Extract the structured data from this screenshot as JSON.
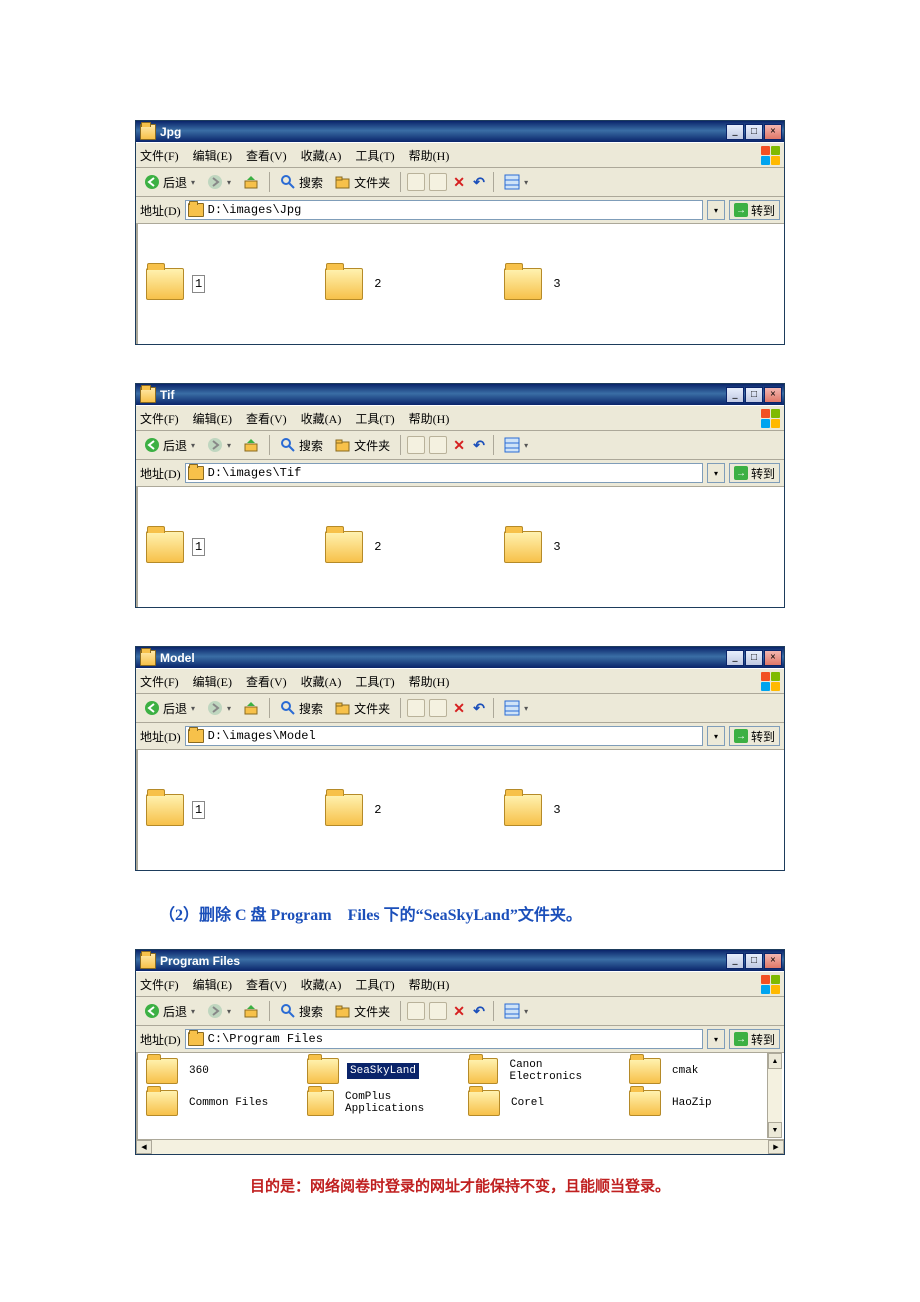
{
  "menu": {
    "file": "文件(F)",
    "edit": "编辑(E)",
    "view": "查看(V)",
    "favorites": "收藏(A)",
    "tools": "工具(T)",
    "help": "帮助(H)"
  },
  "toolbar": {
    "back": "后退",
    "search": "搜索",
    "folders": "文件夹"
  },
  "address": {
    "label": "地址(D)",
    "go": "转到"
  },
  "windows": [
    {
      "title": "Jpg",
      "path": "D:\\images\\Jpg",
      "items": [
        "1",
        "2",
        "3"
      ]
    },
    {
      "title": "Tif",
      "path": "D:\\images\\Tif",
      "items": [
        "1",
        "2",
        "3"
      ]
    },
    {
      "title": "Model",
      "path": "D:\\images\\Model",
      "items": [
        "1",
        "2",
        "3"
      ]
    }
  ],
  "instruction": "（2）删除 C 盘 Program　Files 下的“SeaSkyLand”文件夹。",
  "programFiles": {
    "title": "Program Files",
    "path": "C:\\Program Files",
    "row1": [
      "360",
      "SeaSkyLand",
      "Canon Electronics",
      "cmak"
    ],
    "row2": [
      "Common Files",
      "ComPlus Applications",
      "Corel",
      "HaoZip"
    ]
  },
  "note": "目的是：网络阅卷时登录的网址才能保持不变，且能顺当登录。"
}
